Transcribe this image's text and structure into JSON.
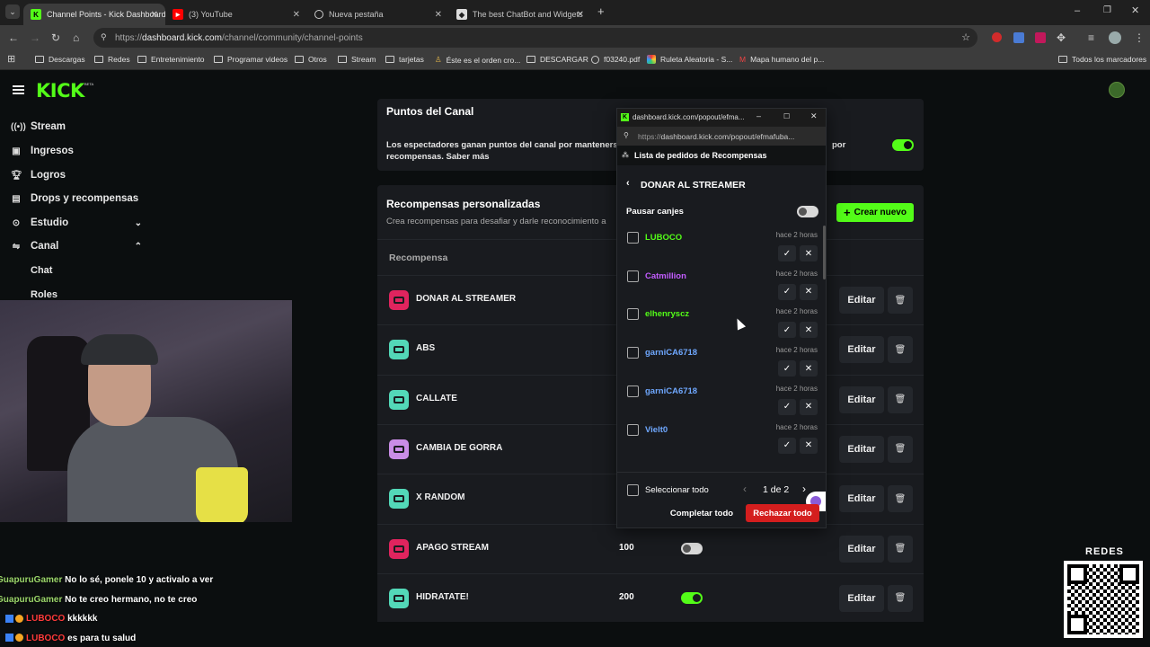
{
  "browser": {
    "tabs": [
      {
        "title": "Channel Points - Kick Dashboard",
        "icon": "kick-icon",
        "active": true
      },
      {
        "title": "(3) YouTube",
        "icon": "youtube-icon",
        "active": false
      },
      {
        "title": "Nueva pestaña",
        "icon": "globe-icon",
        "active": false
      },
      {
        "title": "The best ChatBot and Widgets",
        "icon": "bot-icon",
        "active": false
      }
    ],
    "url_prefix": "https://",
    "url_host": "dashboard.kick.com",
    "url_path": "/channel/community/channel-points",
    "bookmarks": [
      "Descargas",
      "Redes",
      "Entretenimiento",
      "Programar videos",
      "Otros",
      "Stream",
      "tarjetas",
      "Éste es el orden cro...",
      "DESCARGAR",
      "f03240.pdf",
      "Ruleta Aleatoria - S...",
      "Mapa humano del p..."
    ],
    "all_bookmarks": "Todos los marcadores"
  },
  "sidebar": {
    "logo": "KICK",
    "logo_badge": "BETA",
    "items": [
      {
        "label": "Stream",
        "icon": "broadcast-icon"
      },
      {
        "label": "Ingresos",
        "icon": "money-icon"
      },
      {
        "label": "Logros",
        "icon": "trophy-icon"
      },
      {
        "label": "Drops y recompensas",
        "icon": "gift-icon"
      },
      {
        "label": "Estudio",
        "icon": "studio-icon"
      },
      {
        "label": "Canal",
        "icon": "channel-icon"
      },
      {
        "label": "Chat",
        "icon": ""
      },
      {
        "label": "Roles",
        "icon": ""
      }
    ]
  },
  "channel_points": {
    "title": "Puntos del Canal",
    "description": "Los espectadores ganan puntos del canal por mantenerse",
    "description_end": "por",
    "description_line2": "recompensas. Saber más",
    "enabled": true
  },
  "rewards": {
    "title": "Recompensas personalizadas",
    "subtitle": "Crea recompensas para desafiar y darle reconocimiento a",
    "create_button": "Crear nuevo",
    "column_header": "Recompensa",
    "edit_label": "Editar",
    "items": [
      {
        "name": "DONAR AL STREAMER",
        "color": "#e0245e",
        "cost": "",
        "enabled": null
      },
      {
        "name": "ABS",
        "color": "#53d8b8",
        "cost": "",
        "enabled": null
      },
      {
        "name": "CALLATE",
        "color": "#53d8b8",
        "cost": "",
        "enabled": null
      },
      {
        "name": "CAMBIA DE GORRA",
        "color": "#c98de6",
        "cost": "",
        "enabled": null
      },
      {
        "name": "X RANDOM",
        "color": "#53d8b8",
        "cost": "",
        "enabled": null
      },
      {
        "name": "APAGO STREAM",
        "color": "#e0245e",
        "cost": "100",
        "enabled": false
      },
      {
        "name": "HIDRATATE!",
        "color": "#53d8b8",
        "cost": "200",
        "enabled": true
      }
    ]
  },
  "popup": {
    "window_title": "dashboard.kick.com/popout/efma...",
    "url_prefix": "https://",
    "url_rest": "dashboard.kick.com/popout/efmafuba...",
    "header": "Lista de pedidos de Recompensas",
    "reward_title": "DONAR AL STREAMER",
    "pause_label": "Pausar canjes",
    "pause_enabled": false,
    "requests": [
      {
        "user": "LUBOCO",
        "color": "#53fc18",
        "time": "hace 2 horas"
      },
      {
        "user": "Catmillion",
        "color": "#c35cff",
        "time": "hace 2 horas"
      },
      {
        "user": "elhenryscz",
        "color": "#53fc18",
        "time": "hace 2 horas"
      },
      {
        "user": "garniCA6718",
        "color": "#6fa8ff",
        "time": "hace 2 horas"
      },
      {
        "user": "garniCA6718",
        "color": "#6fa8ff",
        "time": "hace 2 horas"
      },
      {
        "user": "Vielt0",
        "color": "#6fa8ff",
        "time": "hace 2 horas"
      }
    ],
    "select_all": "Seleccionar todo",
    "pagination": "1 de 2",
    "complete_all": "Completar todo",
    "reject_all": "Rechazar todo"
  },
  "chat_overlay": [
    {
      "user": "GuapuruGamer",
      "color": "#9bd66b",
      "message": "No lo sé, ponele 10 y activalo a ver",
      "badges": false
    },
    {
      "user": "GuapuruGamer",
      "color": "#9bd66b",
      "message": "No te creo hermano, no te creo",
      "badges": false
    },
    {
      "user": "LUBOCO",
      "color": "#ff3b3b",
      "message": "kkkkkk",
      "badges": true
    },
    {
      "user": "LUBOCO",
      "color": "#ff3b3b",
      "message": "es para tu salud",
      "badges": true
    }
  ],
  "qr_label": "REDES"
}
